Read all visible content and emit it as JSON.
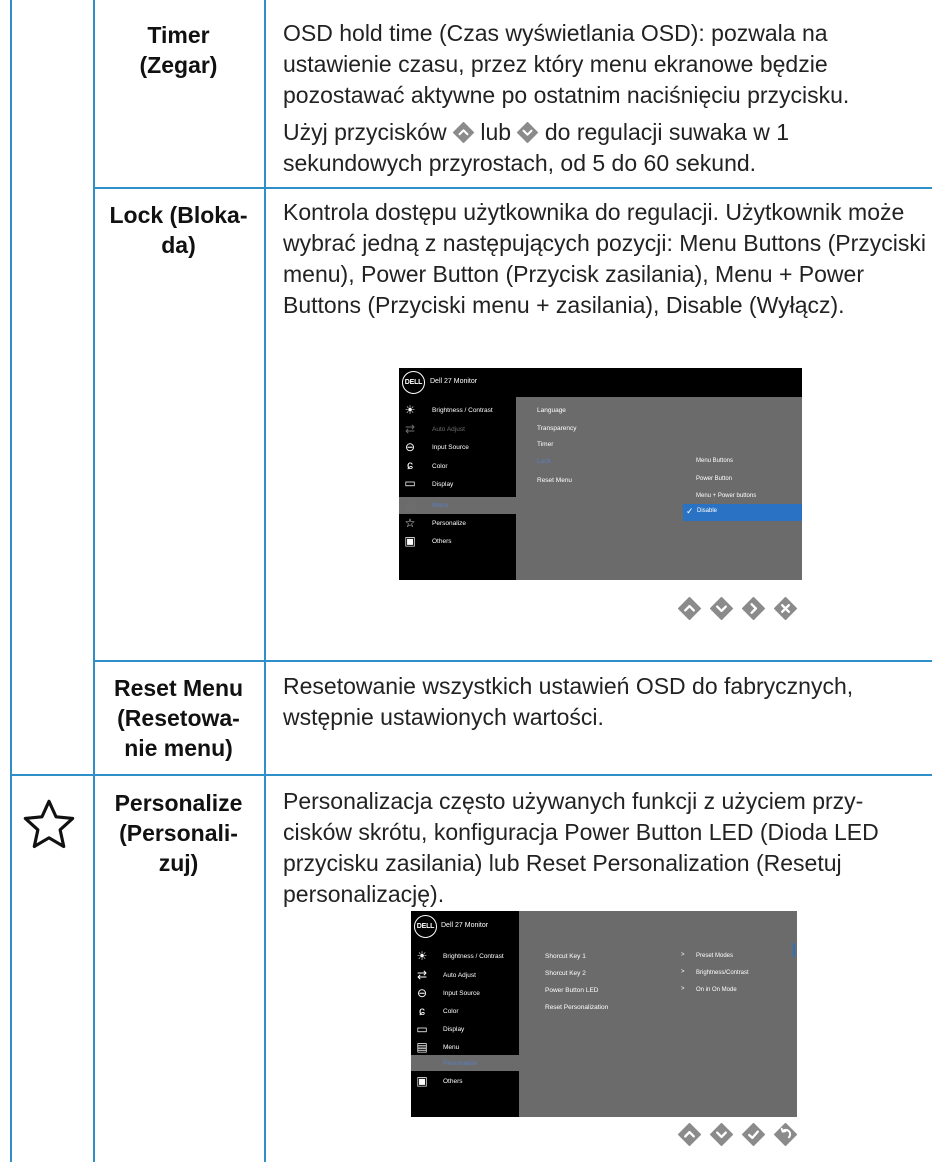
{
  "rows": [
    {
      "label": "Timer\n(Zegar)",
      "desc_p1": "OSD hold time (Czas wyświetlania OSD): pozwala na ustawienie czasu, przez który menu ekranowe będzie pozostawać aktywne po ostatnim naciśnięciu przycisku.",
      "desc_p2_a": "Użyj przycisków",
      "desc_p2_b": "lub",
      "desc_p2_c": "do regulacji suwaka w 1 sekundowych przyrostach, od 5 do 60 sekund."
    },
    {
      "label": "Lock (Bloka-\nda)",
      "desc": "Kontrola dostępu użytkownika do regulacji. Użytkownik może wybrać jedną z następujących pozycji: Menu Buttons (Przyciski menu), Power Button (Przycisk zasilania), Menu + Power Buttons (Przyciski menu + zasilania), Disable (Wyłącz)."
    },
    {
      "label": "Reset Menu\n(Resetowa-\nnie menu)",
      "desc": "Resetowanie wszystkich ustawień OSD do fabrycznych, wstępnie ustawionych wartości."
    },
    {
      "label": "Personalize\n(Personali-\nzuj)",
      "desc": "Personalizacja często używanych funkcji z użyciem przy-cisków skrótu, konfiguracja Power Button LED (Dioda LED przycisku zasilania) lub Reset Personalization (Resetuj personalizację)."
    }
  ],
  "osd1": {
    "logo": "DELL",
    "title": "Dell 27 Monitor",
    "menu": [
      "Brightness / Contrast",
      "Auto Adjust",
      "Input Source",
      "Color",
      "Display",
      "Menu",
      "Personalize",
      "Others"
    ],
    "submenu": [
      "Language",
      "Transparency",
      "Timer",
      "Lock",
      "Reset Menu"
    ],
    "options": [
      "Menu Buttons",
      "Power Button",
      "Menu + Power buttons"
    ],
    "selected_option": "Disable"
  },
  "osd2": {
    "logo": "DELL",
    "title": "Dell 27 Monitor",
    "menu": [
      "Brightness / Contrast",
      "Auto Adjust",
      "Input Source",
      "Color",
      "Display",
      "Menu",
      "Personalize",
      "Others"
    ],
    "submenu": [
      "Shorcut Key 1",
      "Shorcut Key 2",
      "Power Button LED",
      "Reset Personalization"
    ],
    "values": [
      "Preset Modes",
      "Brightness/Contrast",
      "On in On Mode"
    ]
  },
  "colors": {
    "rule": "#2f8fc9",
    "button": "#8b8b8b",
    "osd_bg": "#6b6b6b",
    "highlight": "#2a73c4"
  }
}
